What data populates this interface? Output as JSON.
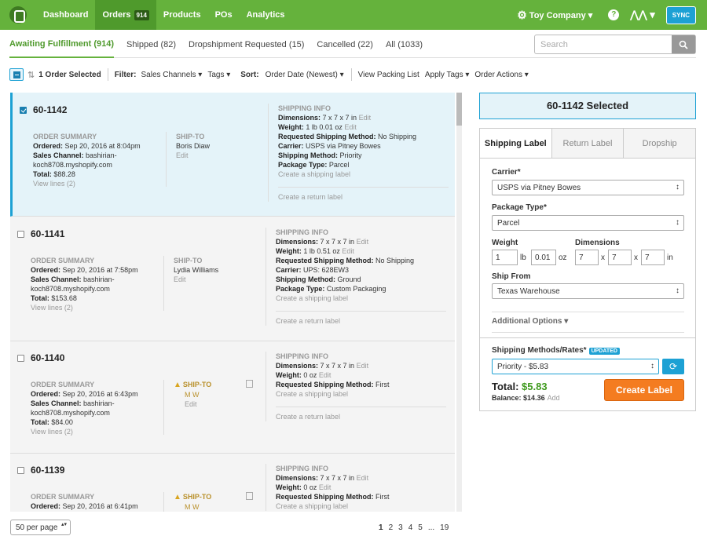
{
  "nav": {
    "items": [
      "Dashboard",
      "Orders",
      "Products",
      "POs",
      "Analytics"
    ],
    "orders_badge": "914",
    "company": "Toy Company ▾",
    "help": "?",
    "pulse": "⋀⋀ ▾",
    "sync": "SYNC"
  },
  "status_tabs": [
    "Awaiting Fulfillment (914)",
    "Shipped (82)",
    "Dropshipment Requested (15)",
    "Cancelled (22)",
    "All (1033)"
  ],
  "search": {
    "placeholder": "Search"
  },
  "toolbar": {
    "selected": "1 Order Selected",
    "filter_label": "Filter:",
    "sales_channels": "Sales Channels ▾",
    "tags": "Tags ▾",
    "sort_label": "Sort:",
    "sort_value": "Order Date (Newest) ▾",
    "packing_list": "View Packing List",
    "apply_tags": "Apply Tags ▾",
    "order_actions": "Order Actions ▾"
  },
  "labels": {
    "order_summary": "ORDER SUMMARY",
    "ship_to": "SHIP-TO",
    "shipping_info": "SHIPPING INFO",
    "ordered": "Ordered:",
    "sales_channel": "Sales Channel:",
    "total": "Total:",
    "view_lines": "View lines (2)",
    "edit": "Edit",
    "dimensions": "Dimensions:",
    "weight": "Weight:",
    "requested_method": "Requested Shipping Method:",
    "carrier": "Carrier:",
    "shipping_method": "Shipping Method:",
    "package_type": "Package Type:",
    "create_shipping": "Create a shipping label",
    "create_return": "Create a return label"
  },
  "orders": [
    {
      "id": "60-1142",
      "ordered": "Sep 20, 2016 at 8:04pm",
      "channel_1": "bashirian-",
      "channel_2": "koch8708.myshopify.com",
      "total": "$88.28",
      "ship_to": "Boris Diaw",
      "dimensions": "7 x 7 x 7 in",
      "weight": "1 lb 0.01 oz",
      "requested": "No Shipping",
      "carrier": "USPS via Pitney Bowes",
      "method": "Priority",
      "package": "Parcel"
    },
    {
      "id": "60-1141",
      "ordered": "Sep 20, 2016 at 7:58pm",
      "channel_1": "bashirian-",
      "channel_2": "koch8708.myshopify.com",
      "total": "$153.68",
      "ship_to": "Lydia Williams",
      "dimensions": "7 x 7 x 7 in",
      "weight": "1 lb 0.51 oz",
      "requested": "No Shipping",
      "carrier": "UPS: 628EW3",
      "method": "Ground",
      "package": "Custom Packaging"
    },
    {
      "id": "60-1140",
      "ordered": "Sep 20, 2016 at 6:43pm",
      "channel_1": "bashirian-",
      "channel_2": "koch8708.myshopify.com",
      "total": "$84.00",
      "ship_to": "M W",
      "dimensions": "7 x 7 x 7 in",
      "weight": "0 oz",
      "requested": "First"
    },
    {
      "id": "60-1139",
      "ordered": "Sep 20, 2016 at 6:41pm",
      "ship_to": "M W",
      "dimensions": "7 x 7 x 7 in",
      "weight": "0 oz",
      "requested": "First"
    }
  ],
  "footer": {
    "per_page": "50 per page",
    "pages": [
      "1",
      "2",
      "3",
      "4",
      "5",
      "...",
      "19"
    ]
  },
  "panel": {
    "selected_title": "60-1142 Selected",
    "tabs": [
      "Shipping Label",
      "Return Label",
      "Dropship"
    ],
    "carrier_label": "Carrier*",
    "carrier_value": "USPS via Pitney Bowes",
    "package_label": "Package Type*",
    "package_value": "Parcel",
    "weight_label": "Weight",
    "weight_lb": "1",
    "weight_oz": "0.01",
    "lb": "lb",
    "oz": "oz",
    "dimensions_label": "Dimensions",
    "dims": [
      "7",
      "7",
      "7"
    ],
    "x": "x",
    "in": "in",
    "ship_from_label": "Ship From",
    "ship_from_value": "Texas Warehouse",
    "additional": "Additional Options ▾",
    "rates_label": "Shipping Methods/Rates*",
    "updated": "UPDATED",
    "rate_value": "Priority - $5.83",
    "total_label": "Total:",
    "total_value": "$5.83",
    "balance_label": "Balance:",
    "balance_value": "$14.36",
    "add": "Add",
    "create": "Create Label"
  },
  "colors": {
    "brand_green": "#65b23c",
    "accent_blue": "#1da1d4",
    "create_orange": "#f47c20"
  }
}
